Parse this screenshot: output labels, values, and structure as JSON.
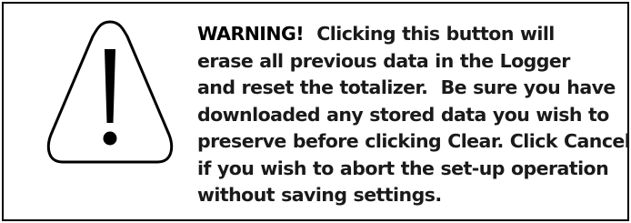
{
  "warning": {
    "icon": "warning-triangle-icon",
    "label": "WARNING!",
    "lines": [
      "Clicking this button will",
      "erase all previous data in the Logger",
      "and reset the totalizer.  Be sure you have",
      "downloaded any stored data you wish to",
      "preserve before clicking Clear. Click Cancel",
      "if you wish to abort the set-up operation",
      "without saving settings."
    ]
  }
}
